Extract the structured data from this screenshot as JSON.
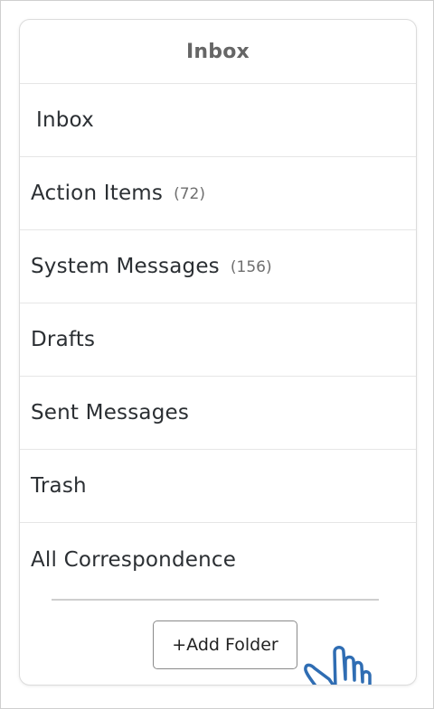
{
  "header": {
    "title": "Inbox"
  },
  "folders": [
    {
      "name": "Inbox",
      "count": ""
    },
    {
      "name": "Action Items",
      "count": "(72)"
    },
    {
      "name": "System Messages",
      "count": "(156)"
    },
    {
      "name": "Drafts",
      "count": ""
    },
    {
      "name": "Sent Messages",
      "count": ""
    },
    {
      "name": "Trash",
      "count": ""
    },
    {
      "name": "All Correspondence",
      "count": ""
    }
  ],
  "footer": {
    "add_folder_label": "+Add Folder"
  },
  "cursor": {
    "icon": "hand-pointer-icon",
    "color": "#2f6db3"
  },
  "colors": {
    "text": "#2b2f33",
    "muted": "#666666",
    "border": "#e6e6e6"
  }
}
